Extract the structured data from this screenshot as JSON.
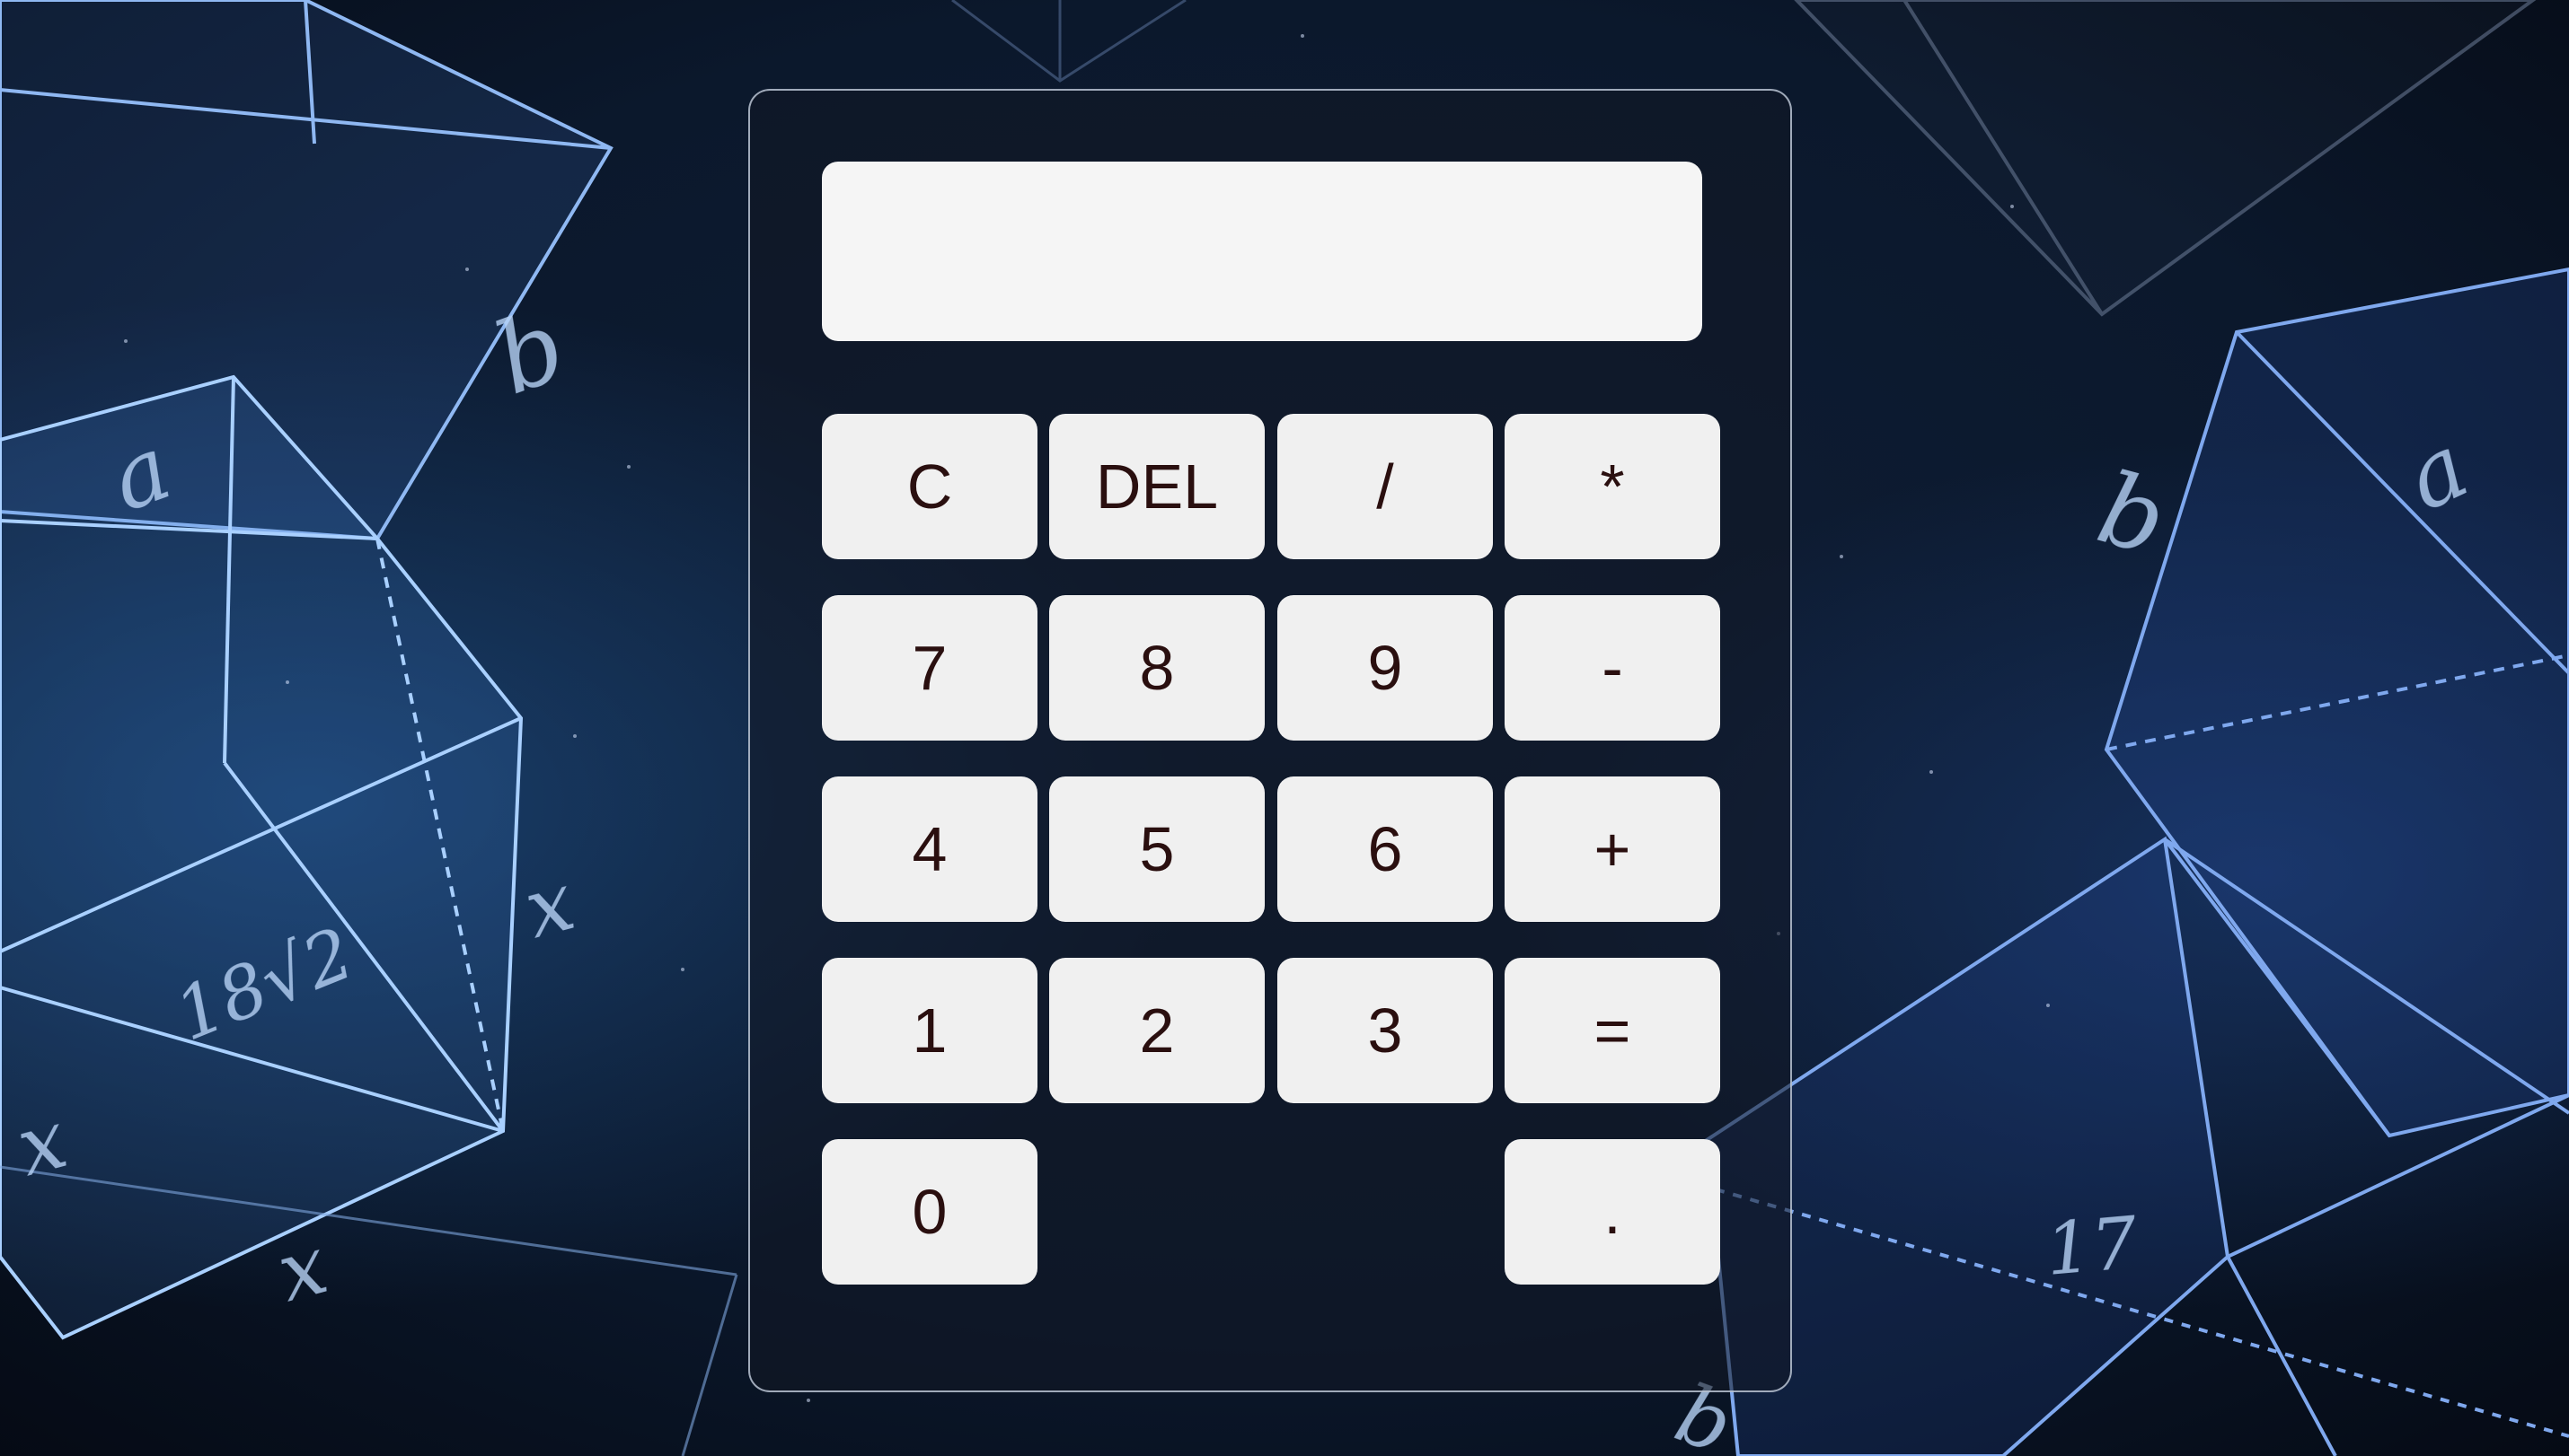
{
  "display": {
    "value": "",
    "placeholder": ""
  },
  "keys": {
    "clear": "C",
    "delete": "DEL",
    "divide": "/",
    "multiply": "*",
    "seven": "7",
    "eight": "8",
    "nine": "9",
    "subtract": "-",
    "four": "4",
    "five": "5",
    "six": "6",
    "add": "+",
    "one": "1",
    "two": "2",
    "three": "3",
    "equals": "=",
    "zero": "0",
    "decimal": "."
  },
  "background": {
    "annotations": {
      "left_top_b": "b",
      "left_a": "a",
      "left_root": "18√2",
      "left_x_right": "x",
      "left_x_bottom_left": "x",
      "left_x_bottom": "x",
      "right_b": "b",
      "right_a": "a",
      "right_17": "17",
      "bottom_b": "b"
    }
  },
  "colors": {
    "page_background": "#0c1a30",
    "panel_border": "#d2dceb",
    "display_background": "#f5f5f5",
    "key_background": "#f0f0f0",
    "key_text": "#2a0f0f",
    "geometry_lines": "#9cc4ff"
  }
}
